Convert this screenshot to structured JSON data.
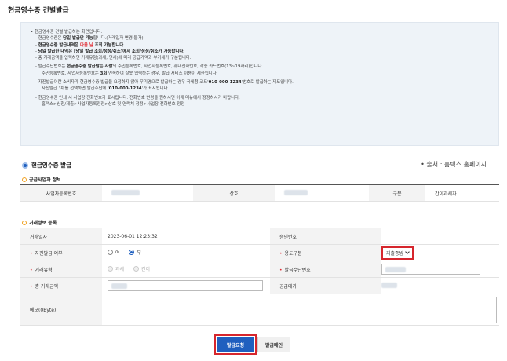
{
  "page_title": "현금영수증 건별발급",
  "notice": {
    "intro": "현금영수증 건별 발급하는 화면입니다.",
    "l1a": "현금영수증은 ",
    "l1b": "당일 발급만 가능",
    "l1c": "합니다.(거래일자 변경 불가)",
    "l2a": "현금영수증 발급내역은 ",
    "l2b": "다음 날",
    "l2c": " 조회 가능합니다.",
    "l3": "당일 발급한 내역은 [당일 발급 조회/정정/취소]에서 조회/정정/취소가 가능합니다.",
    "l4": "총 거래금액을 입력하면 거래유형(과세, 면세)에 따라 공급가액과 부가세가 구분됩니다.",
    "l5a": "발급수단번호는 ",
    "l5b": "현금영수증 발급받는 사람",
    "l5c": "의 주민등록번호, 사업자등록번호, 휴대전화번호, 각종 카드번호(13~19자리)입니다.",
    "l5d_a": "주민등록번호, 사업자등록번호는 ",
    "l5d_b": "3회",
    "l5d_c": " 연속하여 잘못 입력하는 경우, 발급 서비스 이용이 제한됩니다.",
    "l6a": "자진발급이란 소비자가 현금영수증 발급을 요청하지 않아 무기명으로 발급하는 경우 국세청 코드'",
    "l6b": "010-000-1234",
    "l6c": "'번호로 발급하는 제도입니다.",
    "l6d_a": "자진발급 '여'를 선택하면 발급수단에 '",
    "l6d_b": "010-000-1234",
    "l6d_c": "'가 표시됩니다.",
    "l7": "현금영수증 인쇄 시 사업장 전화번호가 표시됩니다. 전화번호 변경을 원하시면 아래 메뉴에서 정정하시기 바랍니다.",
    "l7b": "홈택스>신청/제출>사업자등록정정>상호 및 연락처 정정>사업장 전화번호 정정"
  },
  "section_title": "현금영수증 발급",
  "source": "• 출처 : 홈택스 홈페이지",
  "supplier": {
    "title": "공급사업자 정보",
    "biz_no_label": "사업자등록번호",
    "name_label": "상호",
    "type_label": "구분",
    "type_value": "간이과세자"
  },
  "txn": {
    "title": "거래정보 등록",
    "date_label": "거래일자",
    "date_value": "2023-06-01 12:23:32",
    "approval_label": "승인번호",
    "self_issue_label": "자진발급 여부",
    "self_no": "여",
    "self_yes": "부",
    "usage_label": "용도구분",
    "usage_value": "지출증빙",
    "type_label": "거래유형",
    "type_taxable": "과세",
    "type_simple": "간이",
    "means_label": "발급수단번호",
    "amount_label": "총 거래금액",
    "supply_label": "공급대가",
    "memo_label": "메모(0Byte)"
  },
  "buttons": {
    "issue": "발급요청",
    "cancel": "발급메인"
  },
  "colors": {
    "primary": "#1f5fbf",
    "highlight": "#d6262d",
    "required": "#e0262d"
  }
}
